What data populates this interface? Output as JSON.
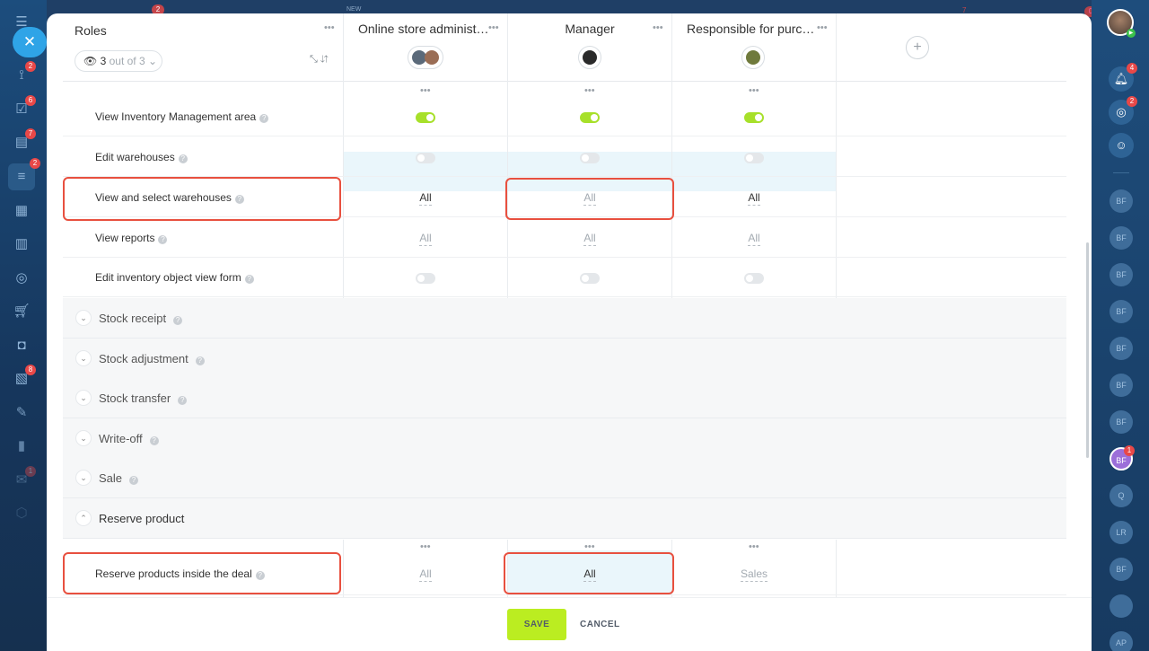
{
  "left_rail": {
    "items": [
      {
        "icon": "menu-icon",
        "badge": ""
      },
      {
        "icon": "flows-icon",
        "badge": "2"
      },
      {
        "icon": "tasks-icon",
        "badge": "6"
      },
      {
        "icon": "crm-icon",
        "badge": "7"
      },
      {
        "icon": "inventory-icon",
        "badge": "2"
      },
      {
        "icon": "calendar-icon",
        "badge": ""
      },
      {
        "icon": "store-icon",
        "badge": ""
      },
      {
        "icon": "target-icon",
        "badge": ""
      },
      {
        "icon": "cart-icon",
        "badge": ""
      },
      {
        "icon": "camera-icon",
        "badge": ""
      },
      {
        "icon": "documents-icon",
        "badge": "8"
      },
      {
        "icon": "sign-icon",
        "badge": ""
      },
      {
        "icon": "analytics-icon",
        "badge": ""
      },
      {
        "icon": "mail-icon",
        "badge": "1"
      },
      {
        "icon": "box-icon",
        "badge": ""
      }
    ]
  },
  "right_rail": {
    "notifications_badge": "4",
    "activity_badge": "2",
    "users": [
      {
        "initials": "BF",
        "active": false,
        "badge": ""
      },
      {
        "initials": "BF",
        "active": false,
        "badge": ""
      },
      {
        "initials": "BF",
        "active": false,
        "badge": ""
      },
      {
        "initials": "BF",
        "active": false,
        "badge": ""
      },
      {
        "initials": "BF",
        "active": false,
        "badge": ""
      },
      {
        "initials": "BF",
        "active": false,
        "badge": ""
      },
      {
        "initials": "BF",
        "active": false,
        "badge": ""
      },
      {
        "initials": "BF",
        "active": true,
        "badge": "1"
      },
      {
        "initials": "Q",
        "active": false,
        "badge": ""
      },
      {
        "initials": "LR",
        "active": false,
        "badge": ""
      },
      {
        "initials": "BF",
        "active": false,
        "badge": ""
      },
      {
        "initials": "",
        "active": false,
        "badge": ""
      },
      {
        "initials": "AP",
        "active": false,
        "badge": ""
      }
    ]
  },
  "top_bar": {
    "new_label": "NEW",
    "badge_left": "2",
    "badge_mid": "7",
    "badge_right": "0"
  },
  "header": {
    "roles_title": "Roles",
    "roles_count_value": "3",
    "roles_count_suffix": "out of 3",
    "roles": [
      {
        "name": "Online store administr…"
      },
      {
        "name": "Manager"
      },
      {
        "name": "Responsible for purch…"
      }
    ],
    "add_role": "+"
  },
  "rows": [
    {
      "label": "View Inventory Management area",
      "type": "toggle",
      "values": [
        "on",
        "on",
        "on"
      ]
    },
    {
      "label": "Edit warehouses",
      "type": "toggle",
      "values": [
        "off",
        "off",
        "off"
      ]
    },
    {
      "label": "View and select warehouses",
      "type": "text",
      "values": [
        "All",
        "All",
        "All"
      ]
    },
    {
      "label": "View reports",
      "type": "text",
      "values": [
        "All",
        "All",
        "All"
      ]
    },
    {
      "label": "Edit inventory object view form",
      "type": "toggle",
      "values": [
        "off",
        "off",
        "off"
      ]
    }
  ],
  "sections": [
    {
      "title": "Stock receipt",
      "open": false
    },
    {
      "title": "Stock adjustment",
      "open": false
    },
    {
      "title": "Stock transfer",
      "open": false
    },
    {
      "title": "Write-off",
      "open": false
    },
    {
      "title": "Sale",
      "open": false
    },
    {
      "title": "Reserve product",
      "open": true
    }
  ],
  "reserve_rows": [
    {
      "label": "Reserve products inside the deal",
      "type": "text",
      "values": [
        "All",
        "All",
        "Sales"
      ]
    }
  ],
  "footer": {
    "save_label": "SAVE",
    "cancel_label": "CANCEL"
  },
  "colors": {
    "accent_green": "#bbed21",
    "toggle_on": "#a7e02a",
    "highlight_red": "#e8503f",
    "selected_cell": "#eaf6fb"
  }
}
